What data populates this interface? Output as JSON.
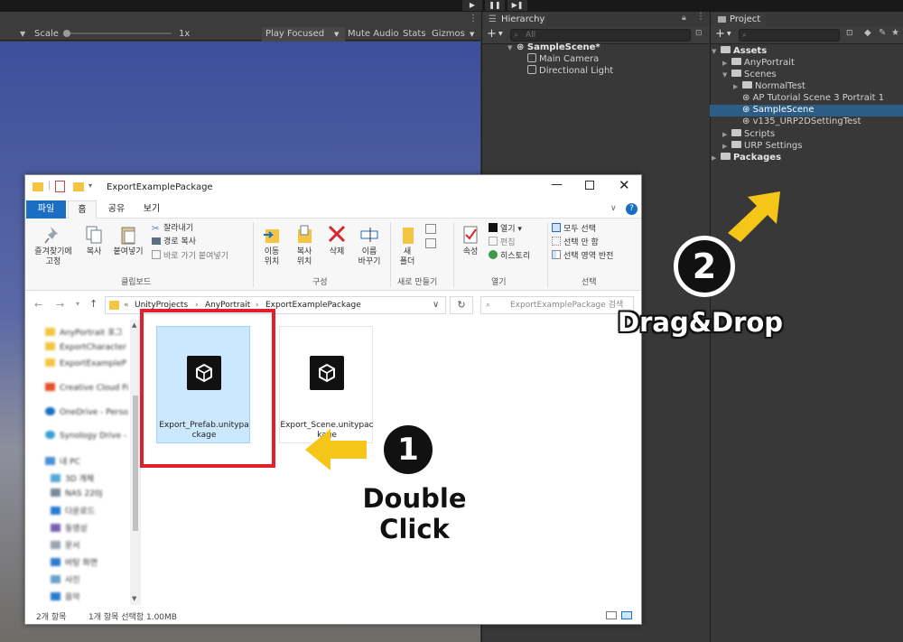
{
  "unity": {
    "game_toolbar": {
      "scale_label": "Scale",
      "scale_value": "1x",
      "play_mode": "Play Focused",
      "mute_audio": "Mute Audio",
      "stats": "Stats",
      "gizmos": "Gizmos"
    },
    "hierarchy": {
      "tab": "Hierarchy",
      "search_placeholder": "All",
      "scene": "SampleScene*",
      "items": [
        "Main Camera",
        "Directional Light"
      ]
    },
    "project": {
      "tab": "Project",
      "tree": [
        {
          "label": "Assets",
          "bold": true
        },
        {
          "label": "AnyPortrait"
        },
        {
          "label": "Scenes"
        },
        {
          "label": "NormalTest"
        },
        {
          "label": "AP Tutorial Scene 3 Portrait 1"
        },
        {
          "label": "SampleScene",
          "selected": true
        },
        {
          "label": "v135_URP2DSettingTest"
        },
        {
          "label": "Scripts"
        },
        {
          "label": "URP Settings"
        },
        {
          "label": "Packages",
          "bold": true
        }
      ]
    }
  },
  "explorer": {
    "title": "ExportExamplePackage",
    "tabs": [
      "파일",
      "홈",
      "공유",
      "보기"
    ],
    "ribbon": {
      "clipboard": {
        "pin": [
          "즐겨찾기에",
          "고정"
        ],
        "copy": "복사",
        "paste": "붙여넣기",
        "cut": "잘라내기",
        "copy_path": "경로 복사",
        "paste_shortcut": "바로 가기 붙여넣기",
        "group": "클립보드"
      },
      "organize": {
        "move": [
          "이동",
          "위치"
        ],
        "copy_to": [
          "복사",
          "위치"
        ],
        "delete": "삭제",
        "rename": [
          "이름",
          "바꾸기"
        ],
        "group": "구성"
      },
      "new": {
        "new_folder": [
          "새",
          "폴더"
        ],
        "group": "새로 만들기"
      },
      "open": {
        "properties": "속성",
        "open": "열기",
        "edit": "편집",
        "history": "히스토리",
        "group": "열기"
      },
      "select": {
        "select_all": "모두 선택",
        "select_none": "선택 안 함",
        "invert": "선택 영역 반전",
        "group": "선택"
      }
    },
    "address": {
      "chevrons": "«",
      "path": [
        "UnityProjects",
        "AnyPortrait",
        "ExportExamplePackage"
      ],
      "search_placeholder": "ExportExamplePackage 검색"
    },
    "nav_items": [
      "AnyPortrait 포그",
      "ExportCharacter",
      "ExportExampleP",
      "Creative Cloud Fi",
      "OneDrive - Perso",
      "Synology Drive -",
      "내 PC",
      "3D 개체",
      "NAS 220J",
      "다운로드",
      "동영상",
      "문서",
      "바탕 화면",
      "사진",
      "음악"
    ],
    "files": [
      {
        "name": "Export_Prefab.unitypackage",
        "selected": true
      },
      {
        "name": "Export_Scene.unitypackage",
        "selected": false
      }
    ],
    "status": {
      "count": "2개 항목",
      "selection": "1개 항목 선택함 1.00MB"
    }
  },
  "annotations": {
    "step1": {
      "number": "1",
      "lines": [
        "Double",
        "Click"
      ]
    },
    "step2": {
      "number": "2",
      "text": "Drag&Drop"
    },
    "colors": {
      "highlight_box": "#e0202a",
      "arrow": "#f5c518"
    }
  }
}
